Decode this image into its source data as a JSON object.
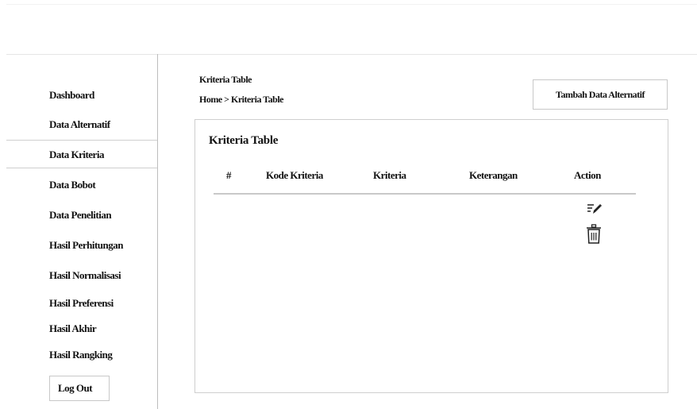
{
  "sidebar": {
    "items": [
      {
        "label": "Dashboard"
      },
      {
        "label": "Data Alternatif"
      },
      {
        "label": "Data Kriteria"
      },
      {
        "label": "Data Bobot"
      },
      {
        "label": "Data Penelitian"
      },
      {
        "label": "Hasil Perhitungan"
      },
      {
        "label": "Hasil Normalisasi"
      },
      {
        "label": "Hasil Preferensi"
      },
      {
        "label": "Hasil Akhir"
      },
      {
        "label": "Hasil Rangking"
      }
    ],
    "active": "Data Kriteria",
    "logout_label": "Log Out"
  },
  "header": {
    "page_title": "Kriteria Table",
    "breadcrumb": "Home > Kriteria Table",
    "add_button_label": "Tambah Data Alternatif"
  },
  "table": {
    "title": "Kriteria Table",
    "columns": [
      "#",
      "Kode Kriteria",
      "Kriteria",
      "Keterangan",
      "Action"
    ],
    "row_actions": {
      "edit_icon": "edit-icon",
      "delete_icon": "trash-icon"
    }
  }
}
